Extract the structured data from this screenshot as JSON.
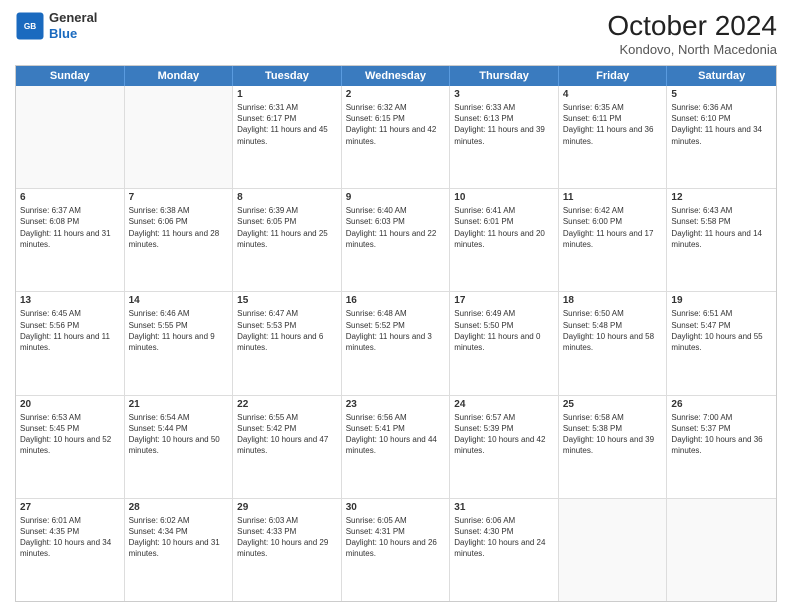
{
  "header": {
    "logo": {
      "general": "General",
      "blue": "Blue"
    },
    "title": "October 2024",
    "location": "Kondovo, North Macedonia"
  },
  "weekdays": [
    "Sunday",
    "Monday",
    "Tuesday",
    "Wednesday",
    "Thursday",
    "Friday",
    "Saturday"
  ],
  "weeks": [
    [
      {
        "day": null
      },
      {
        "day": null
      },
      {
        "day": 1,
        "sunrise": "6:31 AM",
        "sunset": "6:17 PM",
        "daylight": "11 hours and 45 minutes."
      },
      {
        "day": 2,
        "sunrise": "6:32 AM",
        "sunset": "6:15 PM",
        "daylight": "11 hours and 42 minutes."
      },
      {
        "day": 3,
        "sunrise": "6:33 AM",
        "sunset": "6:13 PM",
        "daylight": "11 hours and 39 minutes."
      },
      {
        "day": 4,
        "sunrise": "6:35 AM",
        "sunset": "6:11 PM",
        "daylight": "11 hours and 36 minutes."
      },
      {
        "day": 5,
        "sunrise": "6:36 AM",
        "sunset": "6:10 PM",
        "daylight": "11 hours and 34 minutes."
      }
    ],
    [
      {
        "day": 6,
        "sunrise": "6:37 AM",
        "sunset": "6:08 PM",
        "daylight": "11 hours and 31 minutes."
      },
      {
        "day": 7,
        "sunrise": "6:38 AM",
        "sunset": "6:06 PM",
        "daylight": "11 hours and 28 minutes."
      },
      {
        "day": 8,
        "sunrise": "6:39 AM",
        "sunset": "6:05 PM",
        "daylight": "11 hours and 25 minutes."
      },
      {
        "day": 9,
        "sunrise": "6:40 AM",
        "sunset": "6:03 PM",
        "daylight": "11 hours and 22 minutes."
      },
      {
        "day": 10,
        "sunrise": "6:41 AM",
        "sunset": "6:01 PM",
        "daylight": "11 hours and 20 minutes."
      },
      {
        "day": 11,
        "sunrise": "6:42 AM",
        "sunset": "6:00 PM",
        "daylight": "11 hours and 17 minutes."
      },
      {
        "day": 12,
        "sunrise": "6:43 AM",
        "sunset": "5:58 PM",
        "daylight": "11 hours and 14 minutes."
      }
    ],
    [
      {
        "day": 13,
        "sunrise": "6:45 AM",
        "sunset": "5:56 PM",
        "daylight": "11 hours and 11 minutes."
      },
      {
        "day": 14,
        "sunrise": "6:46 AM",
        "sunset": "5:55 PM",
        "daylight": "11 hours and 9 minutes."
      },
      {
        "day": 15,
        "sunrise": "6:47 AM",
        "sunset": "5:53 PM",
        "daylight": "11 hours and 6 minutes."
      },
      {
        "day": 16,
        "sunrise": "6:48 AM",
        "sunset": "5:52 PM",
        "daylight": "11 hours and 3 minutes."
      },
      {
        "day": 17,
        "sunrise": "6:49 AM",
        "sunset": "5:50 PM",
        "daylight": "11 hours and 0 minutes."
      },
      {
        "day": 18,
        "sunrise": "6:50 AM",
        "sunset": "5:48 PM",
        "daylight": "10 hours and 58 minutes."
      },
      {
        "day": 19,
        "sunrise": "6:51 AM",
        "sunset": "5:47 PM",
        "daylight": "10 hours and 55 minutes."
      }
    ],
    [
      {
        "day": 20,
        "sunrise": "6:53 AM",
        "sunset": "5:45 PM",
        "daylight": "10 hours and 52 minutes."
      },
      {
        "day": 21,
        "sunrise": "6:54 AM",
        "sunset": "5:44 PM",
        "daylight": "10 hours and 50 minutes."
      },
      {
        "day": 22,
        "sunrise": "6:55 AM",
        "sunset": "5:42 PM",
        "daylight": "10 hours and 47 minutes."
      },
      {
        "day": 23,
        "sunrise": "6:56 AM",
        "sunset": "5:41 PM",
        "daylight": "10 hours and 44 minutes."
      },
      {
        "day": 24,
        "sunrise": "6:57 AM",
        "sunset": "5:39 PM",
        "daylight": "10 hours and 42 minutes."
      },
      {
        "day": 25,
        "sunrise": "6:58 AM",
        "sunset": "5:38 PM",
        "daylight": "10 hours and 39 minutes."
      },
      {
        "day": 26,
        "sunrise": "7:00 AM",
        "sunset": "5:37 PM",
        "daylight": "10 hours and 36 minutes."
      }
    ],
    [
      {
        "day": 27,
        "sunrise": "6:01 AM",
        "sunset": "4:35 PM",
        "daylight": "10 hours and 34 minutes."
      },
      {
        "day": 28,
        "sunrise": "6:02 AM",
        "sunset": "4:34 PM",
        "daylight": "10 hours and 31 minutes."
      },
      {
        "day": 29,
        "sunrise": "6:03 AM",
        "sunset": "4:33 PM",
        "daylight": "10 hours and 29 minutes."
      },
      {
        "day": 30,
        "sunrise": "6:05 AM",
        "sunset": "4:31 PM",
        "daylight": "10 hours and 26 minutes."
      },
      {
        "day": 31,
        "sunrise": "6:06 AM",
        "sunset": "4:30 PM",
        "daylight": "10 hours and 24 minutes."
      },
      {
        "day": null
      },
      {
        "day": null
      }
    ]
  ]
}
